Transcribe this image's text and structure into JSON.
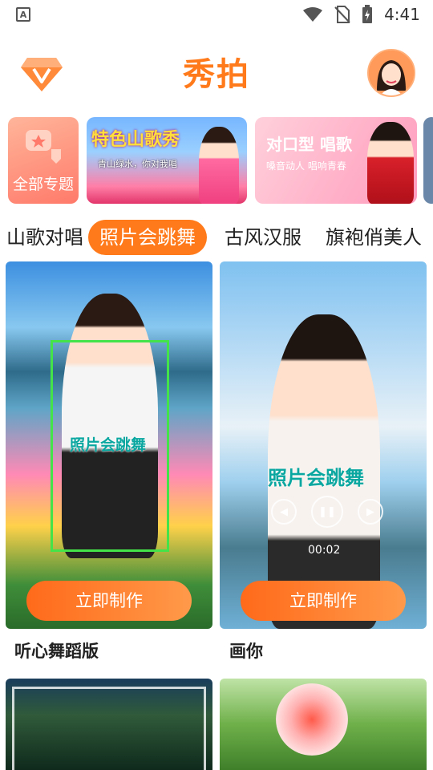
{
  "status_bar": {
    "time": "4:41",
    "left_icon": "A"
  },
  "header": {
    "title": "秀拍"
  },
  "banners": [
    {
      "label": "全部专题"
    },
    {
      "title": "特色山歌秀",
      "subtitle": "青山绿水，你对我唱"
    },
    {
      "title": "对口型 唱歌",
      "subtitle": "嗓音动人 唱响青春"
    }
  ],
  "tabs": [
    "山歌对唱",
    "照片会跳舞",
    "古风汉服",
    "旗袍俏美人"
  ],
  "active_tab": 1,
  "cards": [
    {
      "title": "听心舞蹈版",
      "button": "立即制作",
      "overlay_text": "照片会跳舞"
    },
    {
      "title": "画你",
      "button": "立即制作",
      "overlay_text": "照片会跳舞",
      "player_time": "00:02"
    }
  ],
  "colors": {
    "accent": "#ff7a1a"
  }
}
